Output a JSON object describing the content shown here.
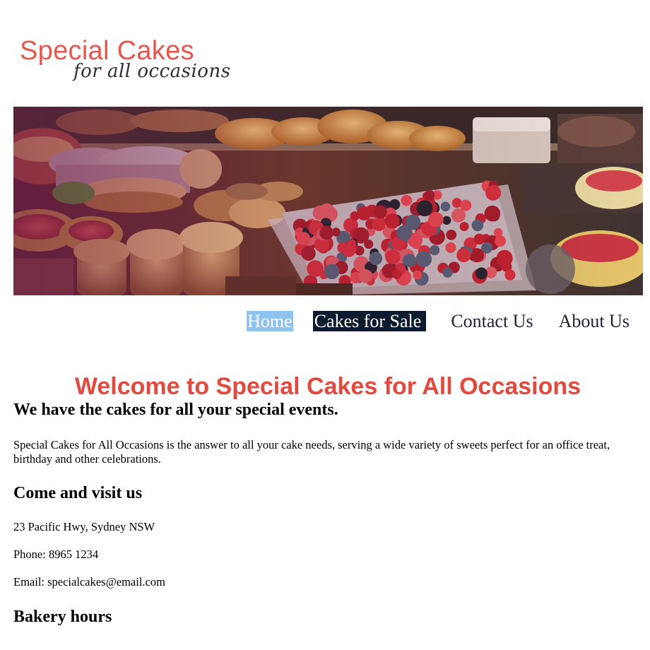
{
  "logo": {
    "main": "Special Cakes",
    "sub": "for all occasions"
  },
  "hero": {
    "icon": "bakery-display-photo"
  },
  "nav": {
    "items": [
      {
        "label": "Home"
      },
      {
        "label": "Cakes for Sale"
      },
      {
        "label": "Contact Us"
      },
      {
        "label": "About Us"
      }
    ]
  },
  "main": {
    "title": "Welcome to Special Cakes for All Occasions",
    "tagline": "We have the cakes for all your special events.",
    "intro": "Special Cakes for All Occasions is the answer to all your cake needs, serving a wide variety of sweets perfect for an office treat, birthday and other celebrations.",
    "visit_heading": "Come and visit us",
    "address": "23 Pacific Hwy, Sydney NSW",
    "phone": "Phone: 8965 1234",
    "email": "Email: specialcakes@email.com",
    "hours_heading": "Bakery hours"
  },
  "colors": {
    "brand_red": "#e04a3f",
    "nav_home_bg": "#8ec3ef",
    "nav_active_bg": "#0e1a2e",
    "text_dark": "#1c2333"
  }
}
